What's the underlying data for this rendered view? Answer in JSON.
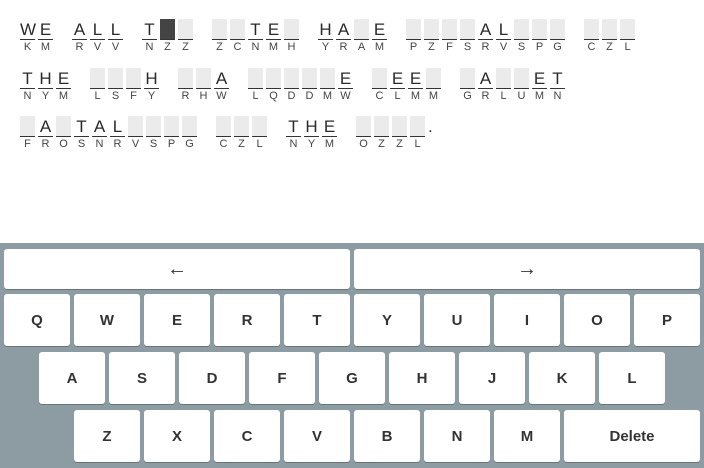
{
  "puzzle": {
    "lines": [
      [
        [
          [
            "W",
            "K"
          ],
          [
            "E",
            "M"
          ]
        ],
        [
          [
            "A",
            "R"
          ],
          [
            "L",
            "V"
          ],
          [
            "L",
            "V"
          ]
        ],
        [
          [
            "T",
            "N"
          ],
          [
            "",
            "Z",
            "active"
          ],
          [
            "",
            "Z"
          ]
        ],
        [
          [
            "",
            "Z"
          ],
          [
            "",
            "C"
          ],
          [
            "T",
            "N"
          ],
          [
            "E",
            "M"
          ],
          [
            "",
            "H"
          ]
        ],
        [
          [
            "H",
            "Y"
          ],
          [
            "A",
            "R"
          ],
          [
            "",
            "A"
          ],
          [
            "E",
            "M"
          ]
        ],
        [
          [
            "",
            "P"
          ],
          [
            "",
            "Z"
          ],
          [
            "",
            "F"
          ],
          [
            "",
            "S"
          ],
          [
            "A",
            "R"
          ],
          [
            "L",
            "V"
          ],
          [
            "",
            "S"
          ],
          [
            "",
            "P"
          ],
          [
            "",
            "G"
          ]
        ],
        [
          [
            "",
            "C"
          ],
          [
            "",
            "Z"
          ],
          [
            "",
            "L"
          ]
        ]
      ],
      [
        [
          [
            "T",
            "N"
          ],
          [
            "H",
            "Y"
          ],
          [
            "E",
            "M"
          ]
        ],
        [
          [
            "",
            "L"
          ],
          [
            "",
            "S"
          ],
          [
            "",
            "F"
          ],
          [
            "H",
            "Y"
          ]
        ],
        [
          [
            "",
            "R"
          ],
          [
            "",
            "H"
          ],
          [
            "A",
            "W"
          ]
        ],
        [
          [
            "",
            "L"
          ],
          [
            "",
            "Q"
          ],
          [
            "",
            "D"
          ],
          [
            "",
            "D"
          ],
          [
            "",
            "M"
          ],
          [
            "E",
            "W"
          ]
        ],
        [
          [
            "",
            "C"
          ],
          [
            "E",
            "L"
          ],
          [
            "E",
            "M"
          ],
          [
            "",
            "M"
          ]
        ],
        [
          [
            "",
            "G"
          ],
          [
            "A",
            "R"
          ],
          [
            "",
            "L"
          ],
          [
            "",
            "U"
          ],
          [
            "E",
            "M"
          ],
          [
            "T",
            "N"
          ]
        ]
      ],
      [
        [
          [
            "",
            "F"
          ],
          [
            "A",
            "R"
          ],
          [
            "",
            "O"
          ],
          [
            "T",
            "S"
          ],
          [
            "A",
            "N"
          ],
          [
            "L",
            "R"
          ],
          [
            "",
            "V"
          ],
          [
            "",
            "S"
          ],
          [
            "",
            "P"
          ],
          [
            "",
            "G"
          ]
        ],
        [
          [
            "",
            "C"
          ],
          [
            "",
            "Z"
          ],
          [
            "",
            "L"
          ]
        ],
        [
          [
            "T",
            "N"
          ],
          [
            "H",
            "Y"
          ],
          [
            "E",
            "M"
          ]
        ],
        [
          [
            "",
            "O"
          ],
          [
            "",
            "Z"
          ],
          [
            "",
            "Z"
          ],
          [
            "",
            "L"
          ]
        ]
      ]
    ],
    "trailing_punct": "."
  },
  "keyboard": {
    "left_arrow": "←",
    "right_arrow": "→",
    "row1": [
      "Q",
      "W",
      "E",
      "R",
      "T",
      "Y",
      "U",
      "I",
      "O",
      "P"
    ],
    "row2": [
      "A",
      "S",
      "D",
      "F",
      "G",
      "H",
      "J",
      "K",
      "L"
    ],
    "row3": [
      "Z",
      "X",
      "C",
      "V",
      "B",
      "N",
      "M"
    ],
    "delete_label": "Delete"
  }
}
